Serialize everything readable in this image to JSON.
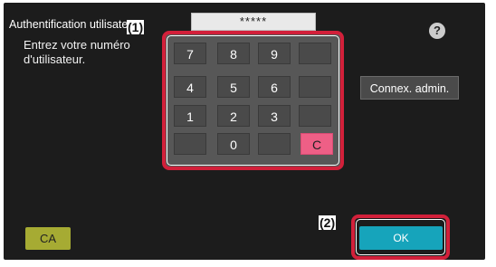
{
  "header": {
    "title": "Authentification utilisateur",
    "help_label": "?"
  },
  "login": {
    "instruction": "Entrez votre numéro\nd'utilisateur.",
    "pin_value": "*****"
  },
  "keypad": {
    "keys": [
      "7",
      "8",
      "9",
      "4",
      "5",
      "6",
      "1",
      "2",
      "3",
      "0"
    ],
    "clear_label": "C"
  },
  "buttons": {
    "admin_login": "Connex. admin.",
    "clear_all": "CA",
    "ok": "OK"
  },
  "annotations": {
    "callout_1": "(1)",
    "callout_2": "(2)",
    "frame_color": "#d2203a"
  },
  "colors": {
    "background": "#1c1c1c",
    "ok_button": "#16a4bb",
    "ca_button": "#a6ab33",
    "clear_key": "#ee5f86"
  }
}
